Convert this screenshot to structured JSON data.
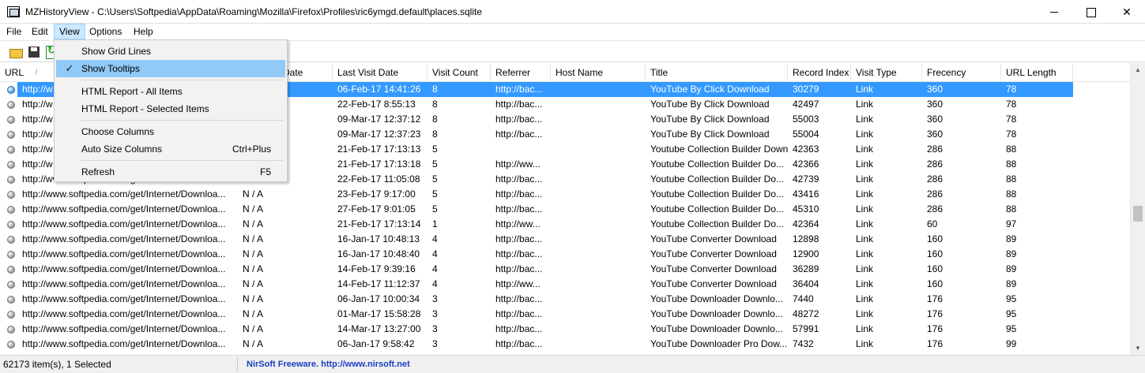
{
  "window": {
    "title": "MZHistoryView  -  C:\\Users\\Softpedia\\AppData\\Roaming\\Mozilla\\Firefox\\Profiles\\ric6ymgd.default\\places.sqlite"
  },
  "menubar": {
    "items": [
      "File",
      "Edit",
      "View",
      "Options",
      "Help"
    ],
    "active": "View"
  },
  "view_menu": {
    "items": [
      {
        "label": "Show Grid Lines",
        "shortcut": "",
        "checked": false
      },
      {
        "label": "Show Tooltips",
        "shortcut": "",
        "checked": true
      },
      {
        "label": "HTML Report - All Items",
        "shortcut": "",
        "checked": false
      },
      {
        "label": "HTML Report - Selected Items",
        "shortcut": "",
        "checked": false
      },
      {
        "label": "Choose Columns",
        "shortcut": "",
        "checked": false
      },
      {
        "label": "Auto Size Columns",
        "shortcut": "Ctrl+Plus",
        "checked": false
      },
      {
        "label": "Refresh",
        "shortcut": "F5",
        "checked": false
      }
    ],
    "check_glyph": "✓"
  },
  "columns": {
    "url": "URL",
    "first_visit": "Date",
    "last_visit": "Last Visit Date",
    "visit_count": "Visit Count",
    "referrer": "Referrer",
    "host_name": "Host Name",
    "title": "Title",
    "record_index": "Record Index",
    "visit_type": "Visit Type",
    "frecency": "Frecency",
    "url_length": "URL Length",
    "sort_glyph": "/"
  },
  "rows": [
    {
      "url": "http://w",
      "first": "",
      "last": "06-Feb-17 14:41:26",
      "count": "8",
      "referrer": "http://bac...",
      "host": "",
      "title": "YouTube By Click Download",
      "index": "30279",
      "type": "Link",
      "frecency": "360",
      "length": "78"
    },
    {
      "url": "http://w",
      "first": "",
      "last": "22-Feb-17 8:55:13",
      "count": "8",
      "referrer": "http://bac...",
      "host": "",
      "title": "YouTube By Click Download",
      "index": "42497",
      "type": "Link",
      "frecency": "360",
      "length": "78"
    },
    {
      "url": "http://w",
      "first": "",
      "last": "09-Mar-17 12:37:12",
      "count": "8",
      "referrer": "http://bac...",
      "host": "",
      "title": "YouTube By Click Download",
      "index": "55003",
      "type": "Link",
      "frecency": "360",
      "length": "78"
    },
    {
      "url": "http://w",
      "first": "",
      "last": "09-Mar-17 12:37:23",
      "count": "8",
      "referrer": "http://bac...",
      "host": "",
      "title": "YouTube By Click Download",
      "index": "55004",
      "type": "Link",
      "frecency": "360",
      "length": "78"
    },
    {
      "url": "http://w",
      "first": "",
      "last": "21-Feb-17 17:13:13",
      "count": "5",
      "referrer": "",
      "host": "",
      "title": "Youtube Collection Builder Download",
      "index": "42363",
      "type": "Link",
      "frecency": "286",
      "length": "88"
    },
    {
      "url": "http://w",
      "first": "",
      "last": "21-Feb-17 17:13:18",
      "count": "5",
      "referrer": "http://ww...",
      "host": "",
      "title": "Youtube Collection Builder Do...",
      "index": "42366",
      "type": "Link",
      "frecency": "286",
      "length": "88"
    },
    {
      "url": "http://www.softpedia.com/get/Internet/Downloa...",
      "first": "N / A",
      "last": "22-Feb-17 11:05:08",
      "count": "5",
      "referrer": "http://bac...",
      "host": "",
      "title": "Youtube Collection Builder Do...",
      "index": "42739",
      "type": "Link",
      "frecency": "286",
      "length": "88"
    },
    {
      "url": "http://www.softpedia.com/get/Internet/Downloa...",
      "first": "N / A",
      "last": "23-Feb-17 9:17:00",
      "count": "5",
      "referrer": "http://bac...",
      "host": "",
      "title": "Youtube Collection Builder Do...",
      "index": "43416",
      "type": "Link",
      "frecency": "286",
      "length": "88"
    },
    {
      "url": "http://www.softpedia.com/get/Internet/Downloa...",
      "first": "N / A",
      "last": "27-Feb-17 9:01:05",
      "count": "5",
      "referrer": "http://bac...",
      "host": "",
      "title": "Youtube Collection Builder Do...",
      "index": "45310",
      "type": "Link",
      "frecency": "286",
      "length": "88"
    },
    {
      "url": "http://www.softpedia.com/get/Internet/Downloa...",
      "first": "N / A",
      "last": "21-Feb-17 17:13:14",
      "count": "1",
      "referrer": "http://ww...",
      "host": "",
      "title": "Youtube Collection Builder Do...",
      "index": "42364",
      "type": "Link",
      "frecency": "60",
      "length": "97"
    },
    {
      "url": "http://www.softpedia.com/get/Internet/Downloa...",
      "first": "N / A",
      "last": "16-Jan-17 10:48:13",
      "count": "4",
      "referrer": "http://bac...",
      "host": "",
      "title": "YouTube Converter Download",
      "index": "12898",
      "type": "Link",
      "frecency": "160",
      "length": "89"
    },
    {
      "url": "http://www.softpedia.com/get/Internet/Downloa...",
      "first": "N / A",
      "last": "16-Jan-17 10:48:40",
      "count": "4",
      "referrer": "http://bac...",
      "host": "",
      "title": "YouTube Converter Download",
      "index": "12900",
      "type": "Link",
      "frecency": "160",
      "length": "89"
    },
    {
      "url": "http://www.softpedia.com/get/Internet/Downloa...",
      "first": "N / A",
      "last": "14-Feb-17 9:39:16",
      "count": "4",
      "referrer": "http://bac...",
      "host": "",
      "title": "YouTube Converter Download",
      "index": "36289",
      "type": "Link",
      "frecency": "160",
      "length": "89"
    },
    {
      "url": "http://www.softpedia.com/get/Internet/Downloa...",
      "first": "N / A",
      "last": "14-Feb-17 11:12:37",
      "count": "4",
      "referrer": "http://ww...",
      "host": "",
      "title": "YouTube Converter Download",
      "index": "36404",
      "type": "Link",
      "frecency": "160",
      "length": "89"
    },
    {
      "url": "http://www.softpedia.com/get/Internet/Downloa...",
      "first": "N / A",
      "last": "06-Jan-17 10:00:34",
      "count": "3",
      "referrer": "http://bac...",
      "host": "",
      "title": "YouTube Downloader Downlo...",
      "index": "7440",
      "type": "Link",
      "frecency": "176",
      "length": "95"
    },
    {
      "url": "http://www.softpedia.com/get/Internet/Downloa...",
      "first": "N / A",
      "last": "01-Mar-17 15:58:28",
      "count": "3",
      "referrer": "http://bac...",
      "host": "",
      "title": "YouTube Downloader Downlo...",
      "index": "48272",
      "type": "Link",
      "frecency": "176",
      "length": "95"
    },
    {
      "url": "http://www.softpedia.com/get/Internet/Downloa...",
      "first": "N / A",
      "last": "14-Mar-17 13:27:00",
      "count": "3",
      "referrer": "http://bac...",
      "host": "",
      "title": "YouTube Downloader Downlo...",
      "index": "57991",
      "type": "Link",
      "frecency": "176",
      "length": "95"
    },
    {
      "url": "http://www.softpedia.com/get/Internet/Downloa...",
      "first": "N / A",
      "last": "06-Jan-17 9:58:42",
      "count": "3",
      "referrer": "http://bac...",
      "host": "",
      "title": "YouTube Downloader Pro Dow...",
      "index": "7432",
      "type": "Link",
      "frecency": "176",
      "length": "99"
    }
  ],
  "selected_row": 0,
  "status": {
    "count": "62173 item(s), 1 Selected",
    "credit": "NirSoft Freeware.  http://www.nirsoft.net"
  },
  "colors": {
    "selection": "#3399ff",
    "menu_highlight": "#91c9f7",
    "credit_link": "#1b3fc4"
  }
}
